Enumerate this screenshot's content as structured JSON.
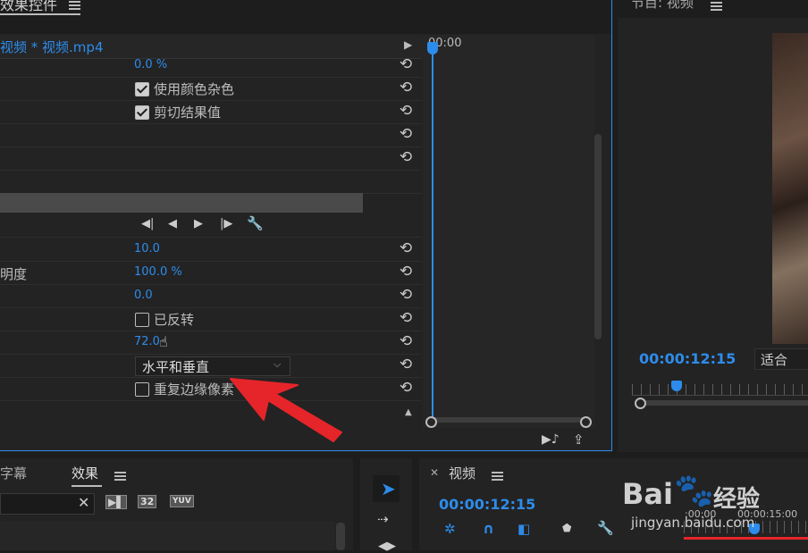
{
  "effect_controls": {
    "tab_title": "效果控件",
    "clip_name": "视频 * 视频.mp4",
    "ruler_time": "00:00",
    "rows": {
      "r1_value": "0.0 %",
      "r2_label": "使用颜色杂色",
      "r3_label": "剪切结果值",
      "r9_value": "10.0",
      "r10_label": "明度",
      "r10_value": "100.0 %",
      "r11_value": "0.0",
      "r12_label": "已反转",
      "r13_value": "72.0",
      "r14_dropdown": "水平和垂直",
      "r15_label": "重复边缘像素"
    }
  },
  "program_monitor": {
    "title": "节目: 视频",
    "timecode": "00:00:12:15",
    "fit": "适合"
  },
  "bottom_left": {
    "tab_captions": "字幕",
    "tab_effects": "效果",
    "badge1": "32",
    "badge2": "YUV"
  },
  "timeline": {
    "title": "视频",
    "timecode": "00:00:12:15",
    "ruler_start": ":00:00",
    "ruler_mark": "00:00:15:00"
  },
  "watermark": {
    "brand": "Bai",
    "brand_cn": "经验",
    "url": "jingyan.baidu.com"
  },
  "colors": {
    "accent": "#2d8ceb",
    "arrow": "#e5252a"
  }
}
